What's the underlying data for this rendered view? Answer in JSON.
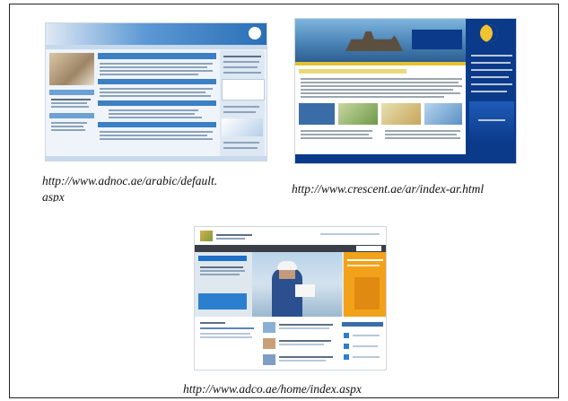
{
  "screenshots": [
    {
      "caption": "http://www.adnoc.ae/arabic/default.\naspx",
      "theme": "light-blue portal"
    },
    {
      "caption": "http://www.crescent.ae/ar/index-ar.html",
      "theme": "dark-blue offshore banner"
    },
    {
      "caption": "http://www.adco.ae/home/index.aspx",
      "theme": "corporate worker photo"
    }
  ],
  "colors": {
    "adnoc_blue": "#3b7fc4",
    "crescent_navy": "#0b3a8a",
    "adco_orange": "#f2a21a"
  }
}
